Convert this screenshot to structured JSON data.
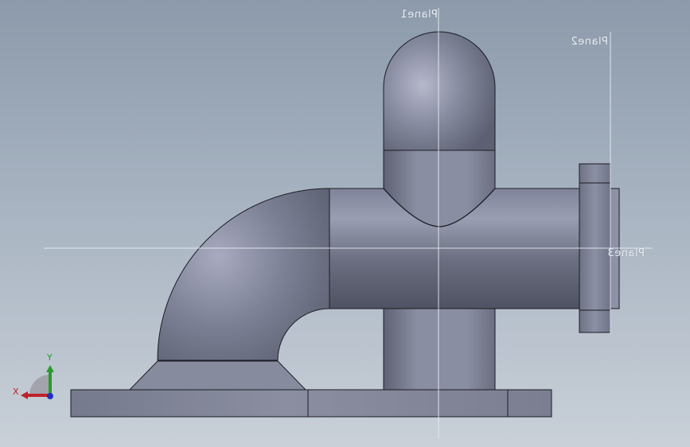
{
  "planes": {
    "plane1": "Plane1",
    "plane2": "Plane2",
    "plane3": "Plane3"
  },
  "triad": {
    "x_label": "X",
    "y_label": "Y",
    "x_color": "#c0202a",
    "y_color": "#2a9a2a",
    "z_color": "#2030c0"
  },
  "colors": {
    "background_top": "#8c9aab",
    "background_bottom": "#c9d0d8",
    "part_body": "#7a7e8e",
    "part_edge": "#1c1c24",
    "plane_line": "#e8ecf2"
  }
}
